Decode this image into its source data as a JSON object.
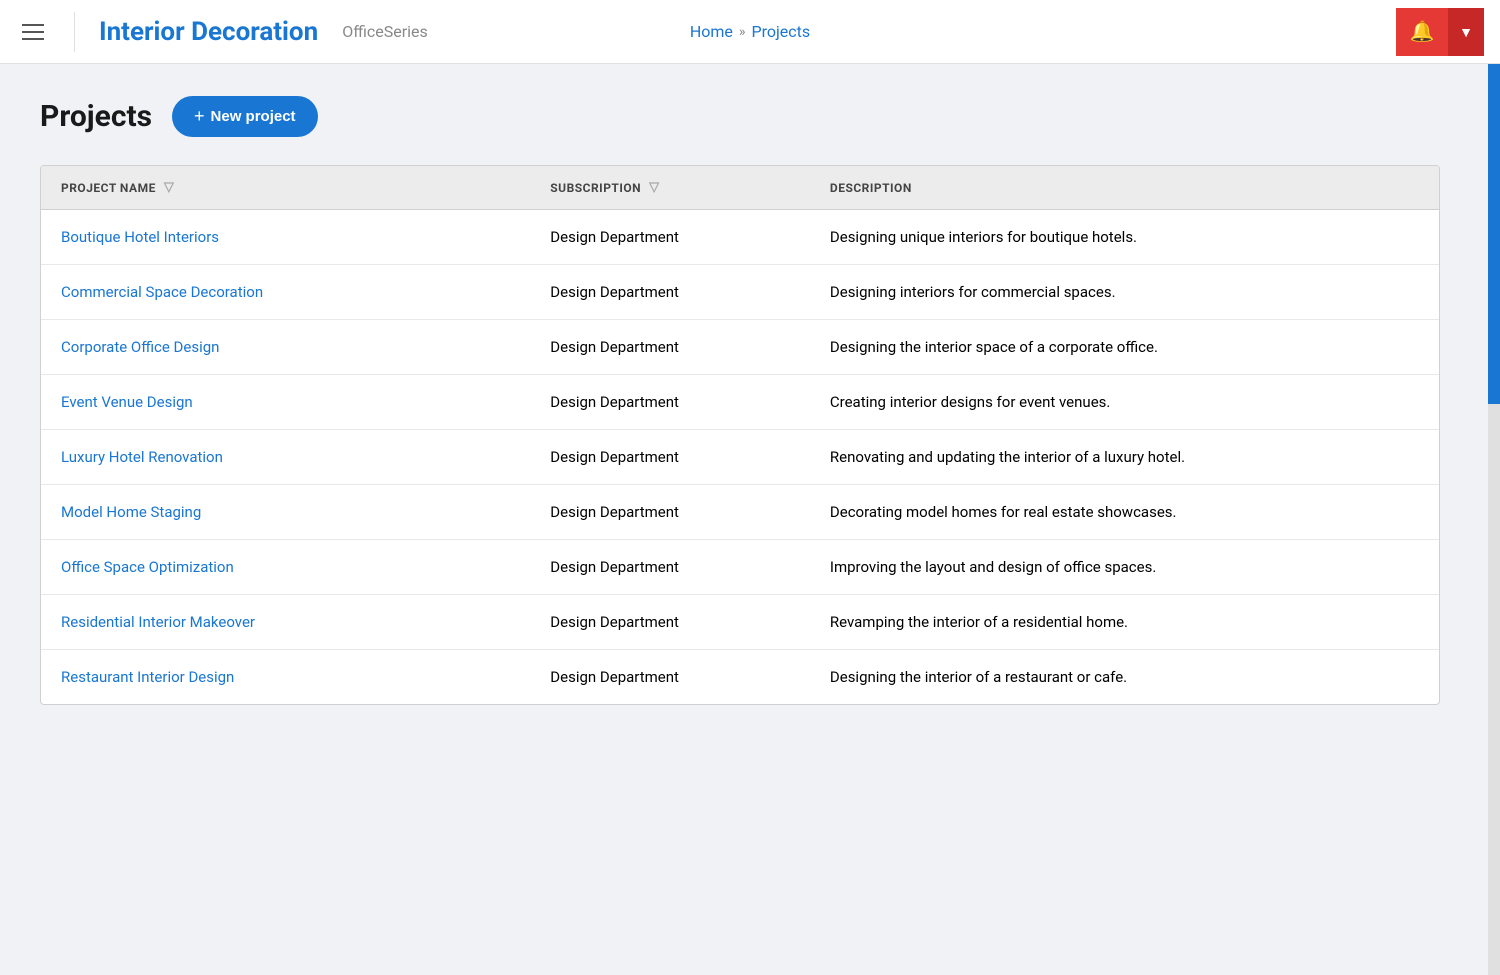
{
  "header": {
    "menu_icon": "hamburger-icon",
    "app_title": "Interior Decoration",
    "app_subtitle": "OfficeSeries",
    "nav": {
      "home": "Home",
      "separator": "»",
      "current": "Projects"
    },
    "bell_icon": "🔔",
    "dropdown_icon": "▼"
  },
  "page": {
    "title": "Projects",
    "new_project_button": "+ New project"
  },
  "table": {
    "columns": [
      {
        "key": "name",
        "label": "PROJECT NAME",
        "has_filter": true
      },
      {
        "key": "subscription",
        "label": "SUBSCRIPTION",
        "has_filter": true
      },
      {
        "key": "description",
        "label": "DESCRIPTION",
        "has_filter": false
      }
    ],
    "rows": [
      {
        "name": "Boutique Hotel Interiors",
        "subscription": "Design Department",
        "description": "Designing unique interiors for boutique hotels."
      },
      {
        "name": "Commercial Space Decoration",
        "subscription": "Design Department",
        "description": "Designing interiors for commercial spaces."
      },
      {
        "name": "Corporate Office Design",
        "subscription": "Design Department",
        "description": "Designing the interior space of a corporate office."
      },
      {
        "name": "Event Venue Design",
        "subscription": "Design Department",
        "description": "Creating interior designs for event venues."
      },
      {
        "name": "Luxury Hotel Renovation",
        "subscription": "Design Department",
        "description": "Renovating and updating the interior of a luxury hotel."
      },
      {
        "name": "Model Home Staging",
        "subscription": "Design Department",
        "description": "Decorating model homes for real estate showcases."
      },
      {
        "name": "Office Space Optimization",
        "subscription": "Design Department",
        "description": "Improving the layout and design of office spaces."
      },
      {
        "name": "Residential Interior Makeover",
        "subscription": "Design Department",
        "description": "Revamping the interior of a residential home."
      },
      {
        "name": "Restaurant Interior Design",
        "subscription": "Design Department",
        "description": "Designing the interior of a restaurant or cafe."
      }
    ]
  },
  "colors": {
    "primary": "#1976d2",
    "header_bg": "#ffffff",
    "table_header_bg": "#ececec",
    "bell_bg": "#e53935",
    "dropdown_bg": "#c62828"
  }
}
